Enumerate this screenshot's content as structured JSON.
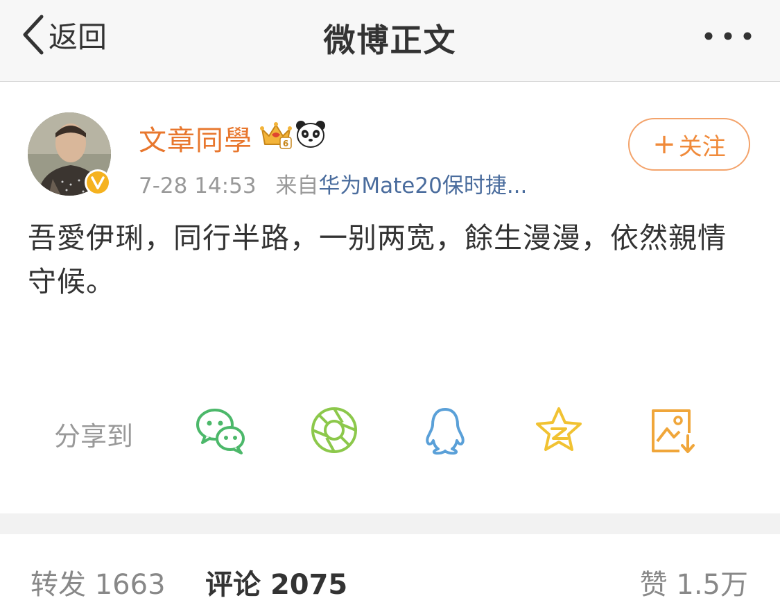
{
  "nav": {
    "back_label": "返回",
    "title": "微博正文"
  },
  "post": {
    "user_name": "文章同學",
    "time": "7-28 14:53",
    "source_prefix": "来自",
    "source": "华为Mate20保时捷...",
    "follow_label": "关注",
    "text": "吾愛伊琍，同行半路，一别两宽，餘生漫漫，依然親情守候。"
  },
  "share": {
    "label": "分享到",
    "targets": [
      "wechat-icon",
      "moments-icon",
      "qq-icon",
      "qzone-icon",
      "save-image-icon"
    ]
  },
  "stats": {
    "repost_label": "转发",
    "repost_count": "1663",
    "comment_label": "评论",
    "comment_count": "2075",
    "like_label": "赞",
    "like_count": "1.5万"
  },
  "colors": {
    "accent": "#e8772e",
    "link": "#4a6c9d",
    "wechat": "#4cb86a",
    "moments": "#8cc84b",
    "qq": "#5aa0d8",
    "qzone": "#f1c232",
    "save": "#f0a63a"
  }
}
